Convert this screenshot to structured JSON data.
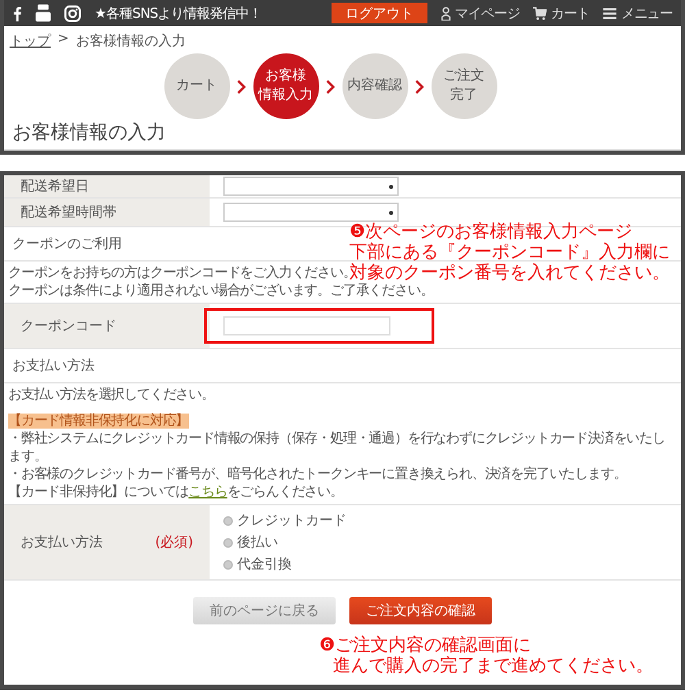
{
  "top_bar": {
    "sns_text": "★各種SNSより情報発信中！",
    "logout_button": "ログアウト",
    "links": [
      {
        "label": "マイページ",
        "kind": "person"
      },
      {
        "label": "カート",
        "kind": "cart"
      },
      {
        "label": "メニュー",
        "kind": "menu"
      }
    ]
  },
  "breadcrumb": {
    "items": [
      "トップ",
      "お客様情報の入力"
    ],
    "separator": ">"
  },
  "steps": [
    {
      "lines": [
        "カート"
      ],
      "selected": false
    },
    {
      "lines": [
        "お客様",
        "情報入力"
      ],
      "selected": true
    },
    {
      "lines": [
        "内容確認"
      ],
      "selected": false
    },
    {
      "lines": [
        "ご注文",
        "完了"
      ],
      "selected": false
    }
  ],
  "page_title": "お客様情報の入力",
  "form": {
    "rows": [
      {
        "label": "配送希望日"
      },
      {
        "label": "配送希望時間帯"
      }
    ],
    "coupon": {
      "title": "クーポンのご利用",
      "notes": [
        "クーポンをお持ちの方はクーポンコードをご入力ください。",
        "クーポンは条件により適用されない場合がございます。ご了承ください。"
      ],
      "label": "クーポンコード"
    },
    "payment": {
      "title": "お支払い方法",
      "intro": "お支払い方法を選択してください。",
      "highlight": "【カード情報非保持化に対応】",
      "notes": [
        "・弊社システムにクレジットカード情報の保持（保存・処理・通過）を行なわずにクレジットカード決済をいたします。",
        "・お客様のクレジットカード番号が、暗号化されたトークンキーに置き換えられ、決済を完了いたします。"
      ],
      "link_note": {
        "before": "【カード非保持化】については",
        "link": "こちら",
        "after": "をごらんください。"
      },
      "label": "お支払い方法",
      "required": "(必須)",
      "options": [
        {
          "label": "クレジットカード",
          "selected": false
        },
        {
          "label": "後払い",
          "selected": false
        },
        {
          "label": "代金引換",
          "selected": false
        }
      ]
    }
  },
  "buttons": [
    {
      "label": "前のページに戻る",
      "kind": "back"
    },
    {
      "label": "ご注文内容の確認",
      "kind": "primary"
    }
  ],
  "annotations": [
    {
      "lines": [
        "❺次ページのお客様情報入力ページ",
        "下部にある『クーポンコード』入力欄に",
        "対象のクーポン番号を入れてください。"
      ]
    },
    {
      "lines": [
        "❻ご注文内容の確認画面に",
        "進んで購入の完了まで進めてください。"
      ]
    }
  ]
}
